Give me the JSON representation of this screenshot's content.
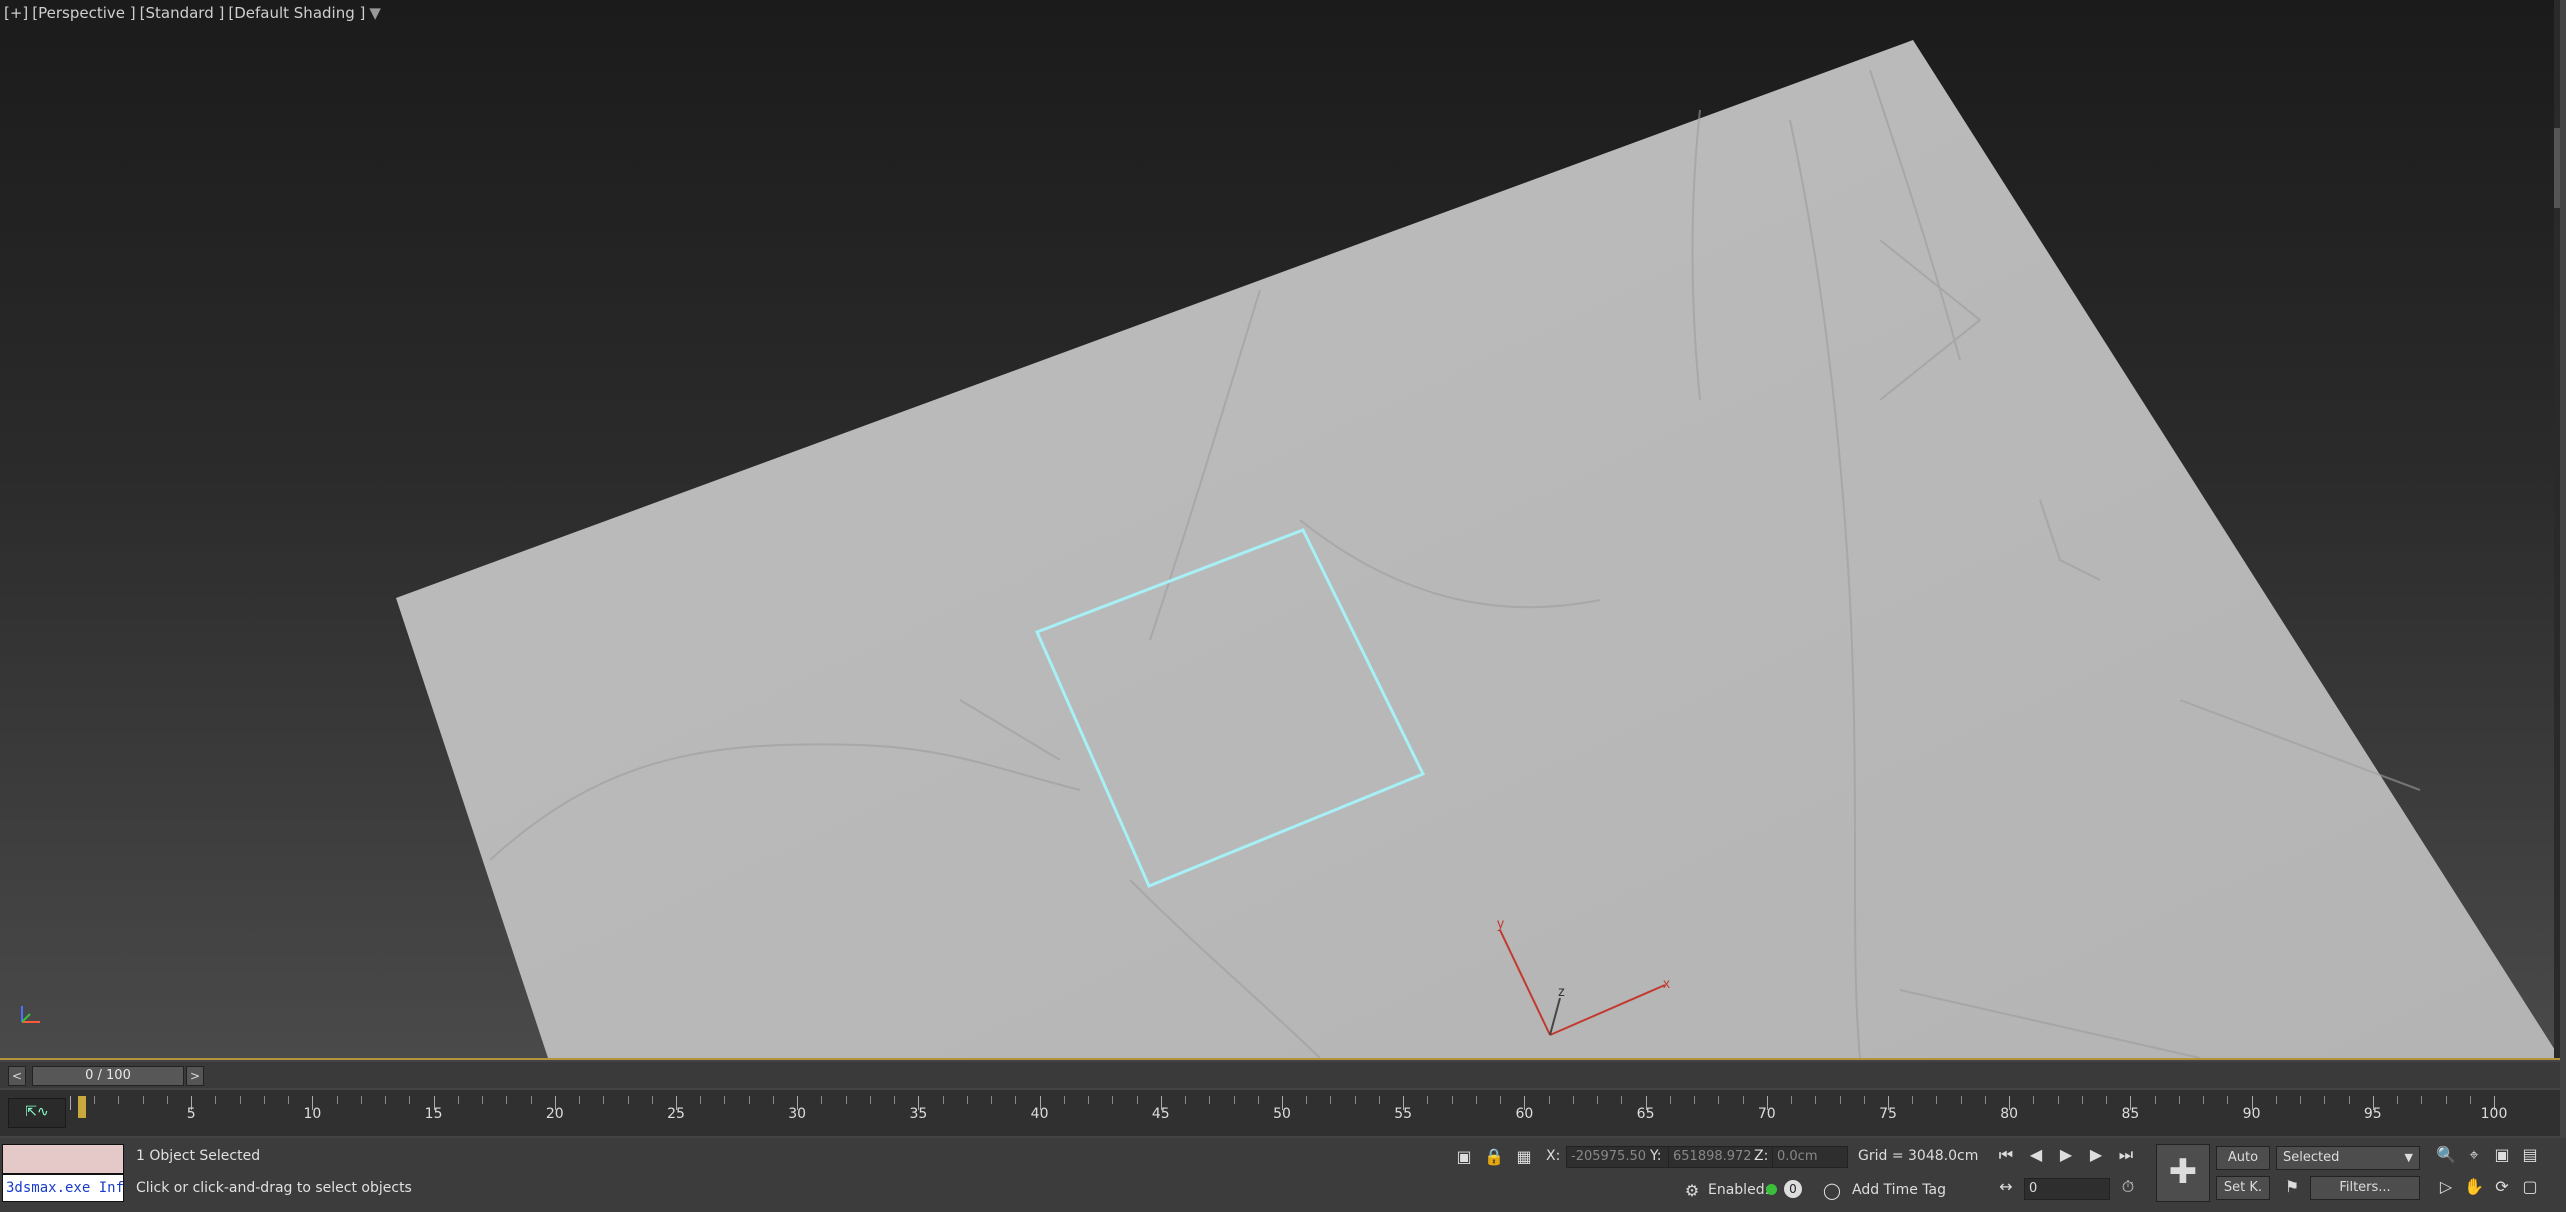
{
  "viewport": {
    "labels": [
      "[+]",
      "[Perspective ]",
      "[Standard ]",
      "[Default Shading ]"
    ],
    "axis_x": "x",
    "axis_y": "y",
    "axis_z": "z"
  },
  "timeslider": {
    "prev": "<",
    "next": ">",
    "position": "0 / 100",
    "current_frame": 0,
    "total_frames": 100
  },
  "track": {
    "icon": "curve-icon",
    "icon_glyph": "⇱∿",
    "ticks": [
      "5",
      "10",
      "15",
      "20",
      "25",
      "30",
      "35",
      "40",
      "45",
      "50",
      "55",
      "60",
      "65",
      "70",
      "75",
      "80",
      "85",
      "90",
      "95",
      "100"
    ]
  },
  "status": {
    "script_text": "3dsmax.exe Inf",
    "selection": "1 Object Selected",
    "prompt": "Click or click-and-drag to select objects",
    "x_label": "X:",
    "x_value": "-205975.50",
    "y_label": "Y:",
    "y_value": "651898.972",
    "z_label": "Z:",
    "z_value": "0.0cm",
    "grid": "Grid = 3048.0cm",
    "enabled": "Enabled:",
    "add_time_tag": "Add Time Tag",
    "auto": "Auto",
    "set_key": "Set K.",
    "key_mode": "Selected",
    "filters": "Filters...",
    "frame_field": "0",
    "enabled_color": "#3bbf3b"
  }
}
